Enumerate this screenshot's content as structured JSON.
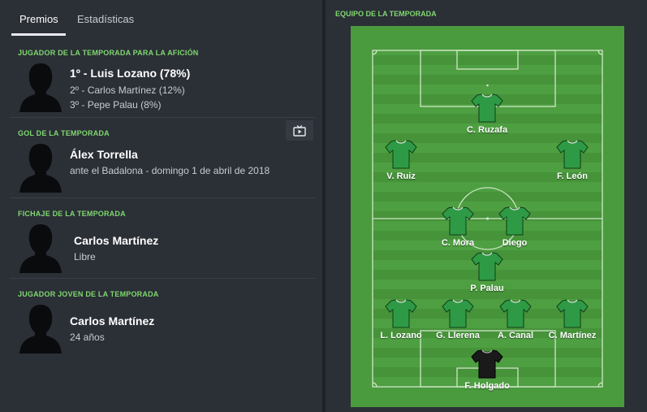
{
  "tabs": [
    {
      "label": "Premios",
      "active": true
    },
    {
      "label": "Estadísticas",
      "active": false
    }
  ],
  "awards": [
    {
      "title": "JUGADOR DE LA TEMPORADA PARA LA AFICIÓN",
      "primary": "1º - Luis Lozano (78%)",
      "secondary": "2º - Carlos Martínez (12%)",
      "tertiary": "3º - Pepe Palau (8%)"
    },
    {
      "title": "GOL DE LA TEMPORADA",
      "primary": "Álex Torrella",
      "secondary": "ante el Badalona - domingo 1 de abril de 2018"
    },
    {
      "title": "FICHAJE DE LA TEMPORADA",
      "primary": "Carlos Martínez",
      "secondary": "Libre"
    },
    {
      "title": "JUGADOR JOVEN DE LA TEMPORADA",
      "primary": "Carlos Martínez",
      "secondary": "24 años"
    }
  ],
  "team": {
    "title": "EQUIPO DE LA TEMPORADA",
    "players": [
      {
        "name": "C. Ruzafa",
        "kit": "outfield"
      },
      {
        "name": "V. Ruiz",
        "kit": "outfield"
      },
      {
        "name": "F. León",
        "kit": "outfield"
      },
      {
        "name": "C. Mora",
        "kit": "outfield"
      },
      {
        "name": "Diego",
        "kit": "outfield"
      },
      {
        "name": "P. Palau",
        "kit": "outfield"
      },
      {
        "name": "L. Lozano",
        "kit": "outfield"
      },
      {
        "name": "G. Llerena",
        "kit": "outfield"
      },
      {
        "name": "A. Canal",
        "kit": "outfield"
      },
      {
        "name": "C. Martínez",
        "kit": "outfield"
      },
      {
        "name": "F. Holgado",
        "kit": "goalkeeper"
      }
    ]
  },
  "icons": {
    "video": "tv-play-icon",
    "silhouette": "player-silhouette-icon"
  },
  "colors": {
    "accent_green": "#7fd86f",
    "pitch_green": "#4a9a3e",
    "outfield_shirt": "#2e9a45",
    "goalkeeper_shirt": "#1a1a1a"
  }
}
